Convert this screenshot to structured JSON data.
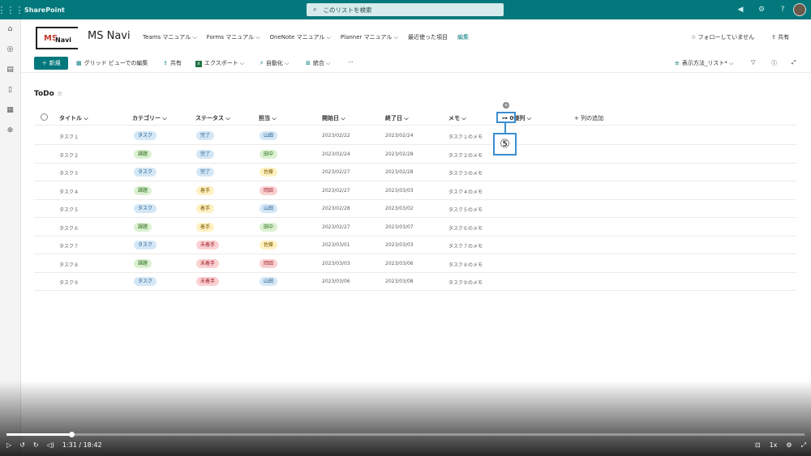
{
  "suite": {
    "app_name": "SharePoint",
    "search_placeholder": "このリストを検索"
  },
  "site": {
    "logo_ms": "MS",
    "logo_navi": "Navi",
    "title": "MS Navi",
    "nav": [
      "Teams マニュアル ⌵",
      "Forms マニュアル ⌵",
      "OneNote マニュアル ⌵",
      "Planner マニュアル ⌵",
      "最近使った項目",
      "編集"
    ],
    "follow": "☆ フォローしていません",
    "share": "共有"
  },
  "command": {
    "new": "＋ 新規",
    "grid": "グリッド ビューでの編集",
    "share": "共有",
    "export": "エクスポート ⌵",
    "automate": "自動化 ⌵",
    "integrate": "統合 ⌵",
    "more": "···",
    "view": "表示方法_リスト* ⌵"
  },
  "list": {
    "title": "ToDo",
    "columns": [
      "タイトル ⌵",
      "カテゴリー ⌵",
      "ステータス ⌵",
      "担当 ⌵",
      "開始日 ⌵",
      "終了日 ⌵",
      "メモ ⌵",
      "⊶ 0値列 ⌵"
    ],
    "add_column": "+ 列の追加",
    "callout": "⑤",
    "rows": [
      {
        "title": "タスク１",
        "cat": "タスク",
        "cat_color": "blue",
        "status": "完了",
        "status_color": "blue",
        "owner": "山田",
        "owner_color": "blue",
        "start": "2023/02/22",
        "end": "2023/02/24",
        "memo": "タスク１のメモ"
      },
      {
        "title": "タスク２",
        "cat": "課題",
        "cat_color": "green",
        "status": "完了",
        "status_color": "blue",
        "owner": "田中",
        "owner_color": "green",
        "start": "2023/02/24",
        "end": "2023/02/28",
        "memo": "タスク２のメモ"
      },
      {
        "title": "タスク３",
        "cat": "タスク",
        "cat_color": "blue",
        "status": "完了",
        "status_color": "blue",
        "owner": "佐藤",
        "owner_color": "yellow",
        "start": "2023/02/27",
        "end": "2023/02/28",
        "memo": "タスク３のメモ"
      },
      {
        "title": "タスク４",
        "cat": "課題",
        "cat_color": "green",
        "status": "着手",
        "status_color": "yellow",
        "owner": "岡田",
        "owner_color": "red",
        "start": "2023/02/27",
        "end": "2023/03/03",
        "memo": "タスク４のメモ"
      },
      {
        "title": "タスク５",
        "cat": "タスク",
        "cat_color": "blue",
        "status": "着手",
        "status_color": "yellow",
        "owner": "山田",
        "owner_color": "blue",
        "start": "2023/02/28",
        "end": "2023/03/02",
        "memo": "タスク５のメモ"
      },
      {
        "title": "タスク６",
        "cat": "課題",
        "cat_color": "green",
        "status": "着手",
        "status_color": "yellow",
        "owner": "田中",
        "owner_color": "green",
        "start": "2023/02/27",
        "end": "2023/03/07",
        "memo": "タスク６のメモ"
      },
      {
        "title": "タスク７",
        "cat": "タスク",
        "cat_color": "blue",
        "status": "未着手",
        "status_color": "red",
        "owner": "佐藤",
        "owner_color": "yellow",
        "start": "2023/03/01",
        "end": "2023/03/03",
        "memo": "タスク７のメモ"
      },
      {
        "title": "タスク８",
        "cat": "課題",
        "cat_color": "green",
        "status": "未着手",
        "status_color": "red",
        "owner": "岡田",
        "owner_color": "red",
        "start": "2023/03/03",
        "end": "2023/03/06",
        "memo": "タスク８のメモ"
      },
      {
        "title": "タスク９",
        "cat": "タスク",
        "cat_color": "blue",
        "status": "未着手",
        "status_color": "red",
        "owner": "山田",
        "owner_color": "blue",
        "start": "2023/03/06",
        "end": "2023/03/08",
        "memo": "タスク９のメモ"
      }
    ]
  },
  "player": {
    "time": "1:31 / 18:42",
    "speed": "1x",
    "progress": 0.081
  },
  "colors": {
    "accent": "#03787c",
    "callout": "#3b8ed0"
  }
}
